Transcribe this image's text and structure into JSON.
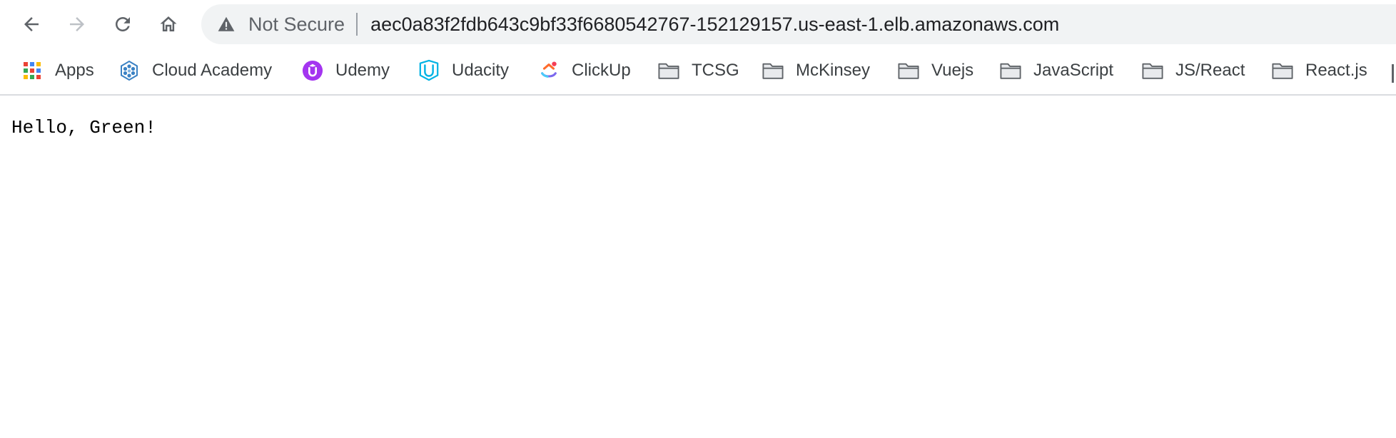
{
  "toolbar": {
    "back_icon": "arrow-left-icon",
    "forward_icon": "arrow-right-icon",
    "reload_icon": "reload-icon",
    "home_icon": "home-icon"
  },
  "omnibox": {
    "security_icon": "warning-triangle-icon",
    "security_label": "Not Secure",
    "url": "aec0a83f2fdb643c9bf33f6680542767-152129157.us-east-1.elb.amazonaws.com"
  },
  "bookmarks": [
    {
      "label": "Apps",
      "icon": "apps-grid-icon"
    },
    {
      "label": "Cloud Academy",
      "icon": "cloud-academy-icon"
    },
    {
      "label": "Udemy",
      "icon": "udemy-icon"
    },
    {
      "label": "Udacity",
      "icon": "udacity-icon"
    },
    {
      "label": "ClickUp",
      "icon": "clickup-icon"
    },
    {
      "label": "TCSG",
      "icon": "folder-icon"
    },
    {
      "label": "McKinsey",
      "icon": "folder-icon"
    },
    {
      "label": "Vuejs",
      "icon": "folder-icon"
    },
    {
      "label": "JavaScript",
      "icon": "folder-icon"
    },
    {
      "label": "JS/React",
      "icon": "folder-icon"
    },
    {
      "label": "React.js",
      "icon": "folder-icon"
    }
  ],
  "page": {
    "text": "Hello, Green!"
  },
  "colors": {
    "omnibox_bg": "#f1f3f4",
    "udemy_purple": "#a435f0",
    "udacity_blue": "#02b3e4",
    "cloud_academy_blue": "#3b82c4"
  }
}
